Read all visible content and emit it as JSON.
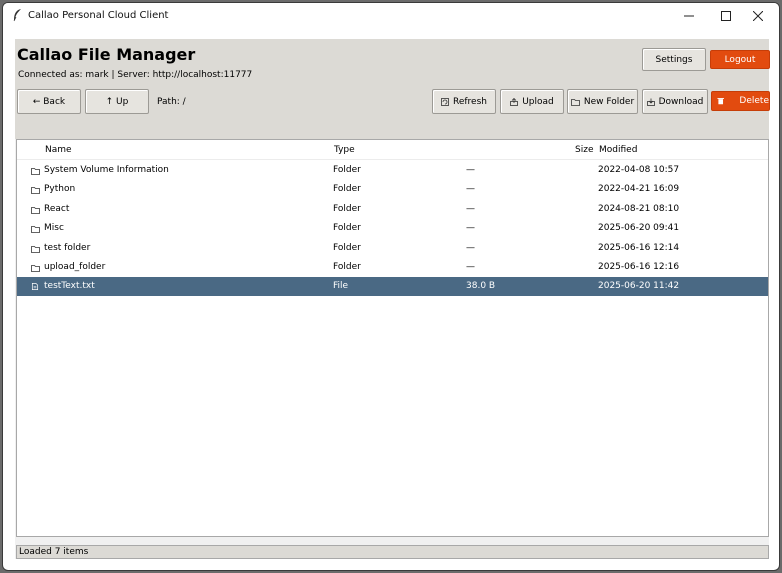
{
  "window": {
    "title": "Callao Personal Cloud Client",
    "controls": [
      "minimize",
      "maximize",
      "close"
    ]
  },
  "header": {
    "app_title": "Callao File Manager",
    "connection_info": "Connected as: mark | Server: http://localhost:11777",
    "settings_label": "Settings",
    "logout_label": "Logout"
  },
  "toolbar": {
    "back_label": "← Back",
    "up_label": "↑ Up",
    "path_label": "Path: /",
    "refresh_label": "Refresh",
    "upload_label": "Upload",
    "new_folder_label": "New Folder",
    "download_label": "Download",
    "delete_label": "Delete"
  },
  "file_list": {
    "columns": {
      "name": "Name",
      "type": "Type",
      "size": "Size",
      "modified": "Modified"
    },
    "rows": [
      {
        "name": "System Volume Information",
        "type": "Folder",
        "size": "—",
        "modified": "2022-04-08 10:57",
        "icon": "folder-icon",
        "selected": false
      },
      {
        "name": "Python",
        "type": "Folder",
        "size": "—",
        "modified": "2022-04-21 16:09",
        "icon": "folder-icon",
        "selected": false
      },
      {
        "name": "React",
        "type": "Folder",
        "size": "—",
        "modified": "2024-08-21 08:10",
        "icon": "folder-icon",
        "selected": false
      },
      {
        "name": "Misc",
        "type": "Folder",
        "size": "—",
        "modified": "2025-06-20 09:41",
        "icon": "folder-icon",
        "selected": false
      },
      {
        "name": "test folder",
        "type": "Folder",
        "size": "—",
        "modified": "2025-06-16 12:14",
        "icon": "folder-icon",
        "selected": false
      },
      {
        "name": "upload_folder",
        "type": "Folder",
        "size": "—",
        "modified": "2025-06-16 12:16",
        "icon": "folder-icon",
        "selected": false
      },
      {
        "name": "testText.txt",
        "type": "File",
        "size": "38.0 B",
        "modified": "2025-06-20 11:42",
        "icon": "file-icon",
        "selected": true
      }
    ]
  },
  "status": {
    "text": "Loaded 7 items"
  },
  "colors": {
    "accent": "#e24b0f",
    "selection": "#4a6984",
    "header_bg": "#dcdad5"
  }
}
